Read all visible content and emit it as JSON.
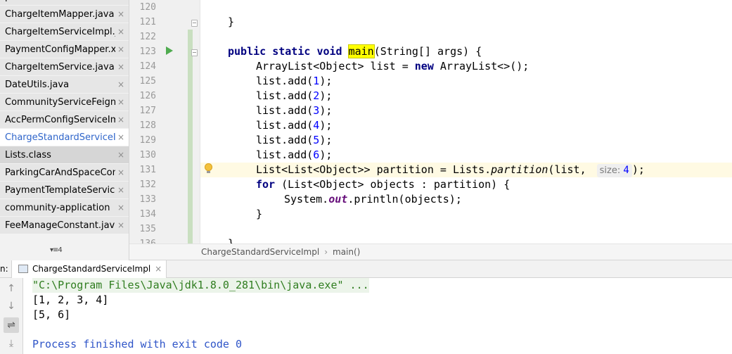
{
  "file_tabs": [
    {
      "label": "pom.xml",
      "state": "partial"
    },
    {
      "label": "ChargeItemMapper.java",
      "state": "normal"
    },
    {
      "label": "ChargeItemServiceImpl.java",
      "state": "normal"
    },
    {
      "label": "PaymentConfigMapper.xml",
      "state": "normal"
    },
    {
      "label": "ChargeItemService.java",
      "state": "normal"
    },
    {
      "label": "DateUtils.java",
      "state": "normal"
    },
    {
      "label": "CommunityServiceFeignService.java",
      "state": "normal"
    },
    {
      "label": "AccPermConfigServiceImpl.java",
      "state": "normal"
    },
    {
      "label": "ChargeStandardServiceImpl.java",
      "state": "active"
    },
    {
      "label": "Lists.class",
      "state": "selected"
    },
    {
      "label": "ParkingCarAndSpaceController.java",
      "state": "normal"
    },
    {
      "label": "PaymentTemplateServiceImpl.java",
      "state": "normal"
    },
    {
      "label": "community-application",
      "state": "normal"
    },
    {
      "label": "FeeManageConstant.java",
      "state": "normal"
    }
  ],
  "tab_close_glyph": "×",
  "tabs_more_label": "▾≡4",
  "editor": {
    "line_numbers": [
      "120",
      "121",
      "122",
      "123",
      "124",
      "125",
      "126",
      "127",
      "128",
      "129",
      "130",
      "131",
      "132",
      "133",
      "134",
      "135",
      "136"
    ],
    "code": {
      "l121_brace": "}",
      "l123_kw1": "public",
      "l123_kw2": "static",
      "l123_kw3": "void",
      "l123_name": "main",
      "l123_rest": "(String[] args) {",
      "l124_pre": "ArrayList<Object> list = ",
      "l124_kw": "new",
      "l124_post": " ArrayList<>();",
      "adds": [
        {
          "pre": "list.add(",
          "num": "1",
          "post": ");"
        },
        {
          "pre": "list.add(",
          "num": "2",
          "post": ");"
        },
        {
          "pre": "list.add(",
          "num": "3",
          "post": ");"
        },
        {
          "pre": "list.add(",
          "num": "4",
          "post": ");"
        },
        {
          "pre": "list.add(",
          "num": "5",
          "post": ");"
        },
        {
          "pre": "list.add(",
          "num": "6",
          "post": ");"
        }
      ],
      "l131_pre": "List<List<Object>> partition = Lists.",
      "l131_call": "partition",
      "l131_args": "(list, ",
      "l131_hint": "size:",
      "l131_num": "4",
      "l131_end": ");",
      "l132_kw": "for",
      "l132_rest": " (List<Object> objects : partition) {",
      "l133_pre": "System.",
      "l133_field": "out",
      "l133_post": ".println(objects);",
      "l134_brace": "}",
      "l136_brace": "}"
    }
  },
  "breadcrumb": {
    "class_name": "ChargeStandardServiceImpl",
    "separator": "›",
    "method": "main()"
  },
  "run_panel": {
    "label": "n:",
    "tab_label": "ChargeStandardServiceImpl",
    "tab_close": "×",
    "toolbar_glyphs": {
      "up": "↑",
      "down": "↓",
      "wrap": "⇌",
      "scroll_end": "⤓"
    },
    "console_lines": [
      {
        "text": "\"C:\\Program Files\\Java\\jdk1.8.0_281\\bin\\java.exe\" ...",
        "kind": "cmd"
      },
      {
        "text": "[1, 2, 3, 4]",
        "kind": "out"
      },
      {
        "text": "[5, 6]",
        "kind": "out"
      },
      {
        "text": "",
        "kind": "out"
      },
      {
        "text": "Process finished with exit code 0",
        "kind": "proc"
      }
    ]
  }
}
